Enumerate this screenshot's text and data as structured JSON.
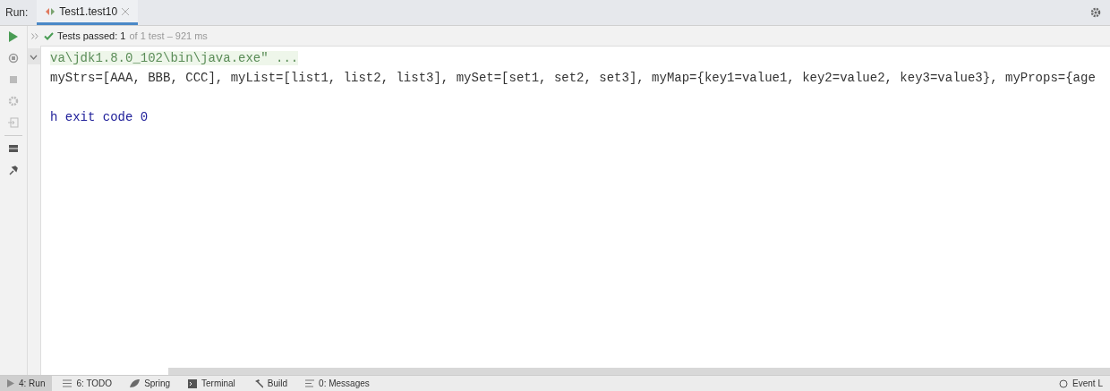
{
  "run_header": {
    "label": "Run:",
    "tabs": [
      {
        "label": "Test1.test10",
        "selected": true
      }
    ]
  },
  "test_status": {
    "passed": "Tests passed: 1",
    "detail": "of 1 test – 921 ms"
  },
  "console": {
    "lines": [
      {
        "kind": "command",
        "text": "va\\jdk1.8.0_102\\bin\\java.exe\" ..."
      },
      {
        "kind": "output",
        "text": "myStrs=[AAA, BBB, CCC], myList=[list1, list2, list3], mySet=[set1, set2, set3], myMap={key1=value1, key2=value2, key3=value3}, myProps={age"
      },
      {
        "kind": "blank"
      },
      {
        "kind": "exit",
        "text": "h exit code 0"
      }
    ]
  },
  "tool_windows": [
    {
      "label": "4: Run",
      "selected": true
    },
    {
      "label": "6: TODO",
      "selected": false
    },
    {
      "label": "Spring",
      "selected": false
    },
    {
      "label": "Terminal",
      "selected": false
    },
    {
      "label": "Build",
      "selected": false
    },
    {
      "label": "0: Messages",
      "selected": false
    }
  ],
  "event_log": {
    "label": "Event L"
  }
}
